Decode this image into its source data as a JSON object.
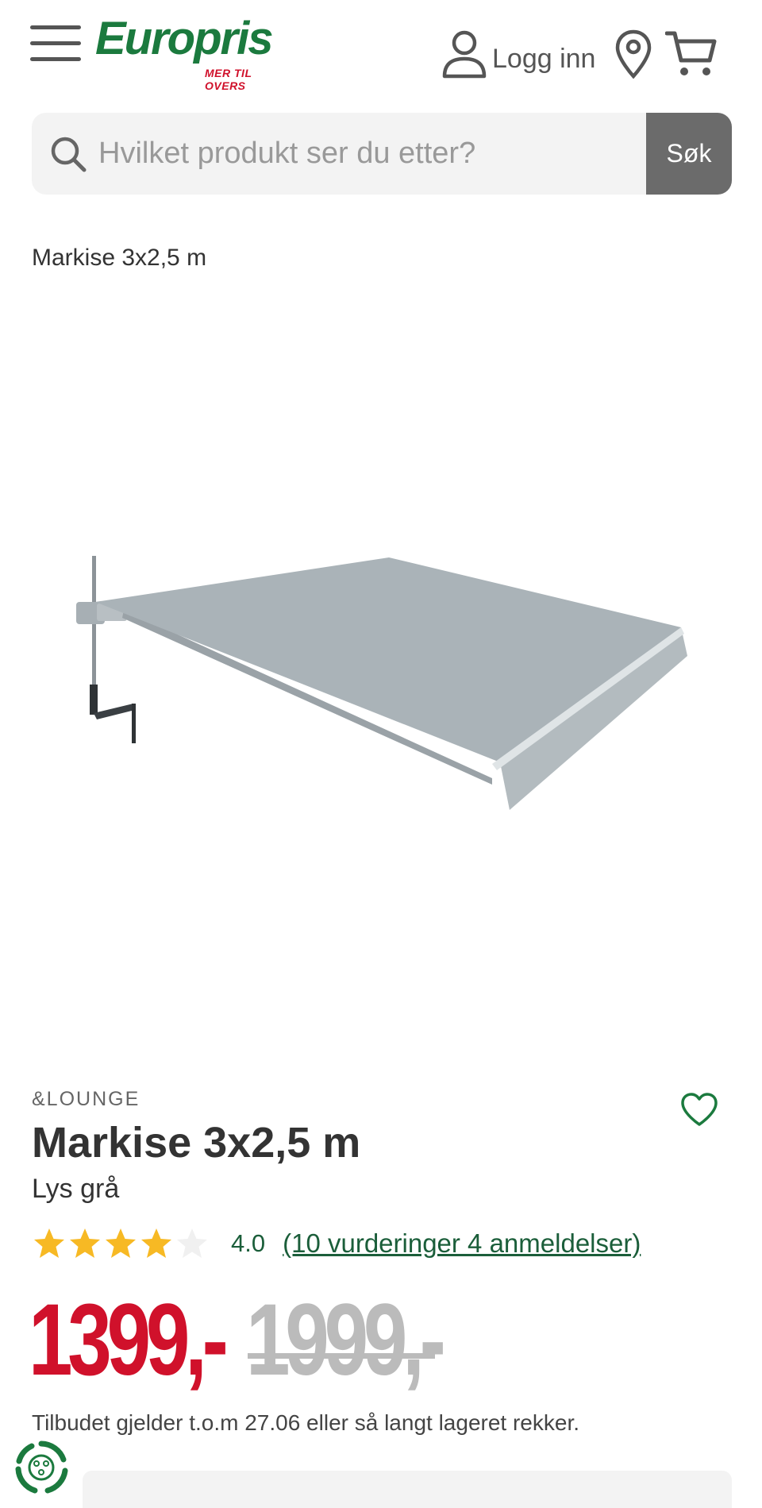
{
  "header": {
    "logo_text": "Europris",
    "logo_tagline": "MER TIL OVERS",
    "login_label": "Logg inn"
  },
  "search": {
    "placeholder": "Hvilket produkt ser du etter?",
    "button_label": "Søk"
  },
  "breadcrumb": "Markise 3x2,5 m",
  "product": {
    "brand": "&LOUNGE",
    "title": "Markise 3x2,5 m",
    "variant": "Lys grå",
    "rating_value": "4.0",
    "rating_stars": 4,
    "rating_max": 5,
    "rating_link": "(10 vurderinger 4 anmeldelser)",
    "price": "1399,-",
    "old_price": "1999,-",
    "offer_text": "Tilbudet gjelder t.o.m 27.06 eller så langt lageret rekker."
  },
  "colors": {
    "brand_green": "#1b7a3e",
    "price_red": "#d0112b",
    "star_yellow": "#f7b924"
  },
  "icons": [
    "hamburger-icon",
    "user-icon",
    "location-icon",
    "cart-icon",
    "search-icon",
    "heart-icon",
    "star-icon",
    "recycle-icon"
  ]
}
